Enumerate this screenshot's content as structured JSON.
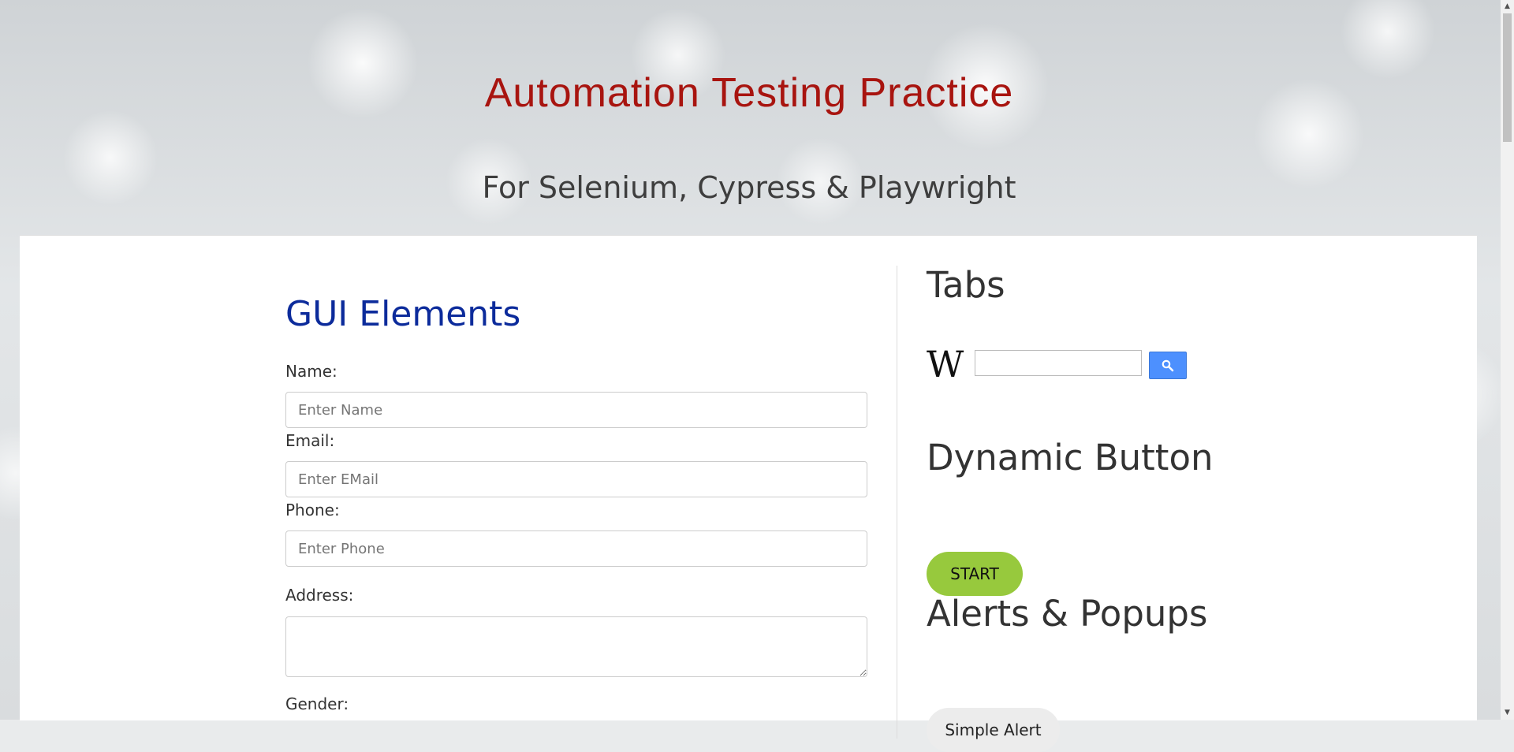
{
  "header": {
    "title": "Automation Testing Practice",
    "subtitle": "For Selenium, Cypress & Playwright",
    "title_color": "#a8140f"
  },
  "gui": {
    "heading": "GUI Elements",
    "heading_color": "#0c2b9b",
    "name_label": "Name:",
    "name_placeholder": "Enter Name",
    "email_label": "Email:",
    "email_placeholder": "Enter EMail",
    "phone_label": "Phone:",
    "phone_placeholder": "Enter Phone",
    "address_label": "Address:",
    "gender_label": "Gender:"
  },
  "tabs": {
    "heading": "Tabs",
    "wiki_icon": "wikipedia-logo-icon",
    "search_icon": "search-icon"
  },
  "dynamic": {
    "heading": "Dynamic Button",
    "start_label": "START",
    "start_color": "#97c93d"
  },
  "alerts": {
    "heading": "Alerts & Popups",
    "simple_alert_label": "Simple Alert"
  }
}
